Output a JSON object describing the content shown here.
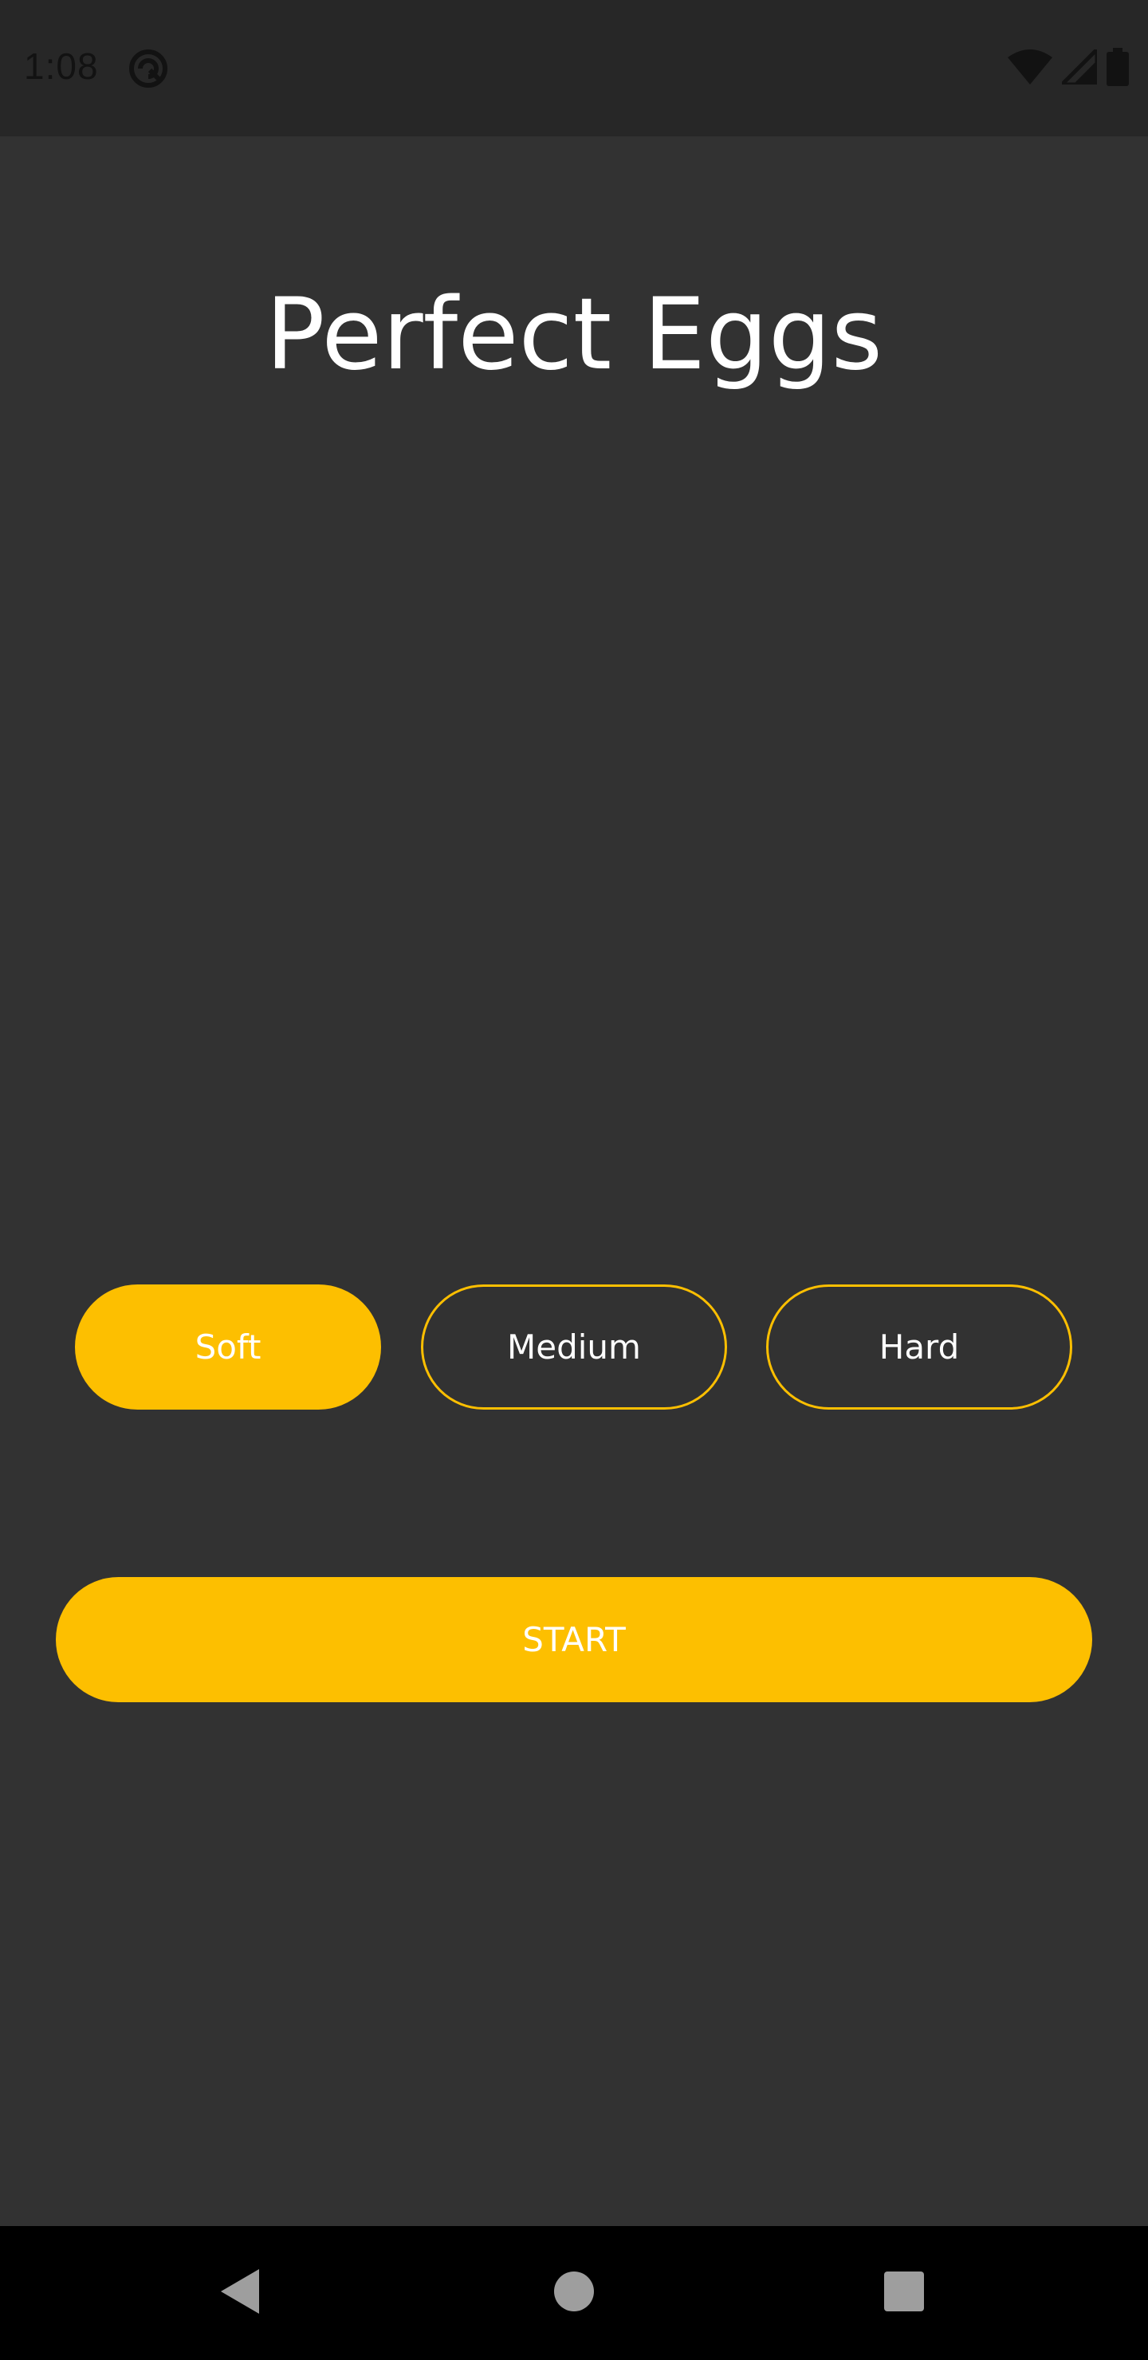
{
  "status_bar": {
    "time": "1:08",
    "icons": [
      "app-notification-icon",
      "wifi-icon",
      "signal-icon",
      "battery-icon"
    ]
  },
  "app": {
    "title": "Perfect Eggs",
    "options": [
      {
        "label": "Soft",
        "selected": true
      },
      {
        "label": "Medium",
        "selected": false
      },
      {
        "label": "Hard",
        "selected": false
      }
    ],
    "start_label": "START"
  },
  "navigation": {
    "buttons": [
      "back-icon",
      "home-icon",
      "recents-icon"
    ]
  },
  "colors": {
    "background": "#323232",
    "status_bar": "#272727",
    "accent": "#fdbf00",
    "text": "#ffffff",
    "nav_bar": "#000000",
    "nav_icons": "#9e9e9e"
  }
}
